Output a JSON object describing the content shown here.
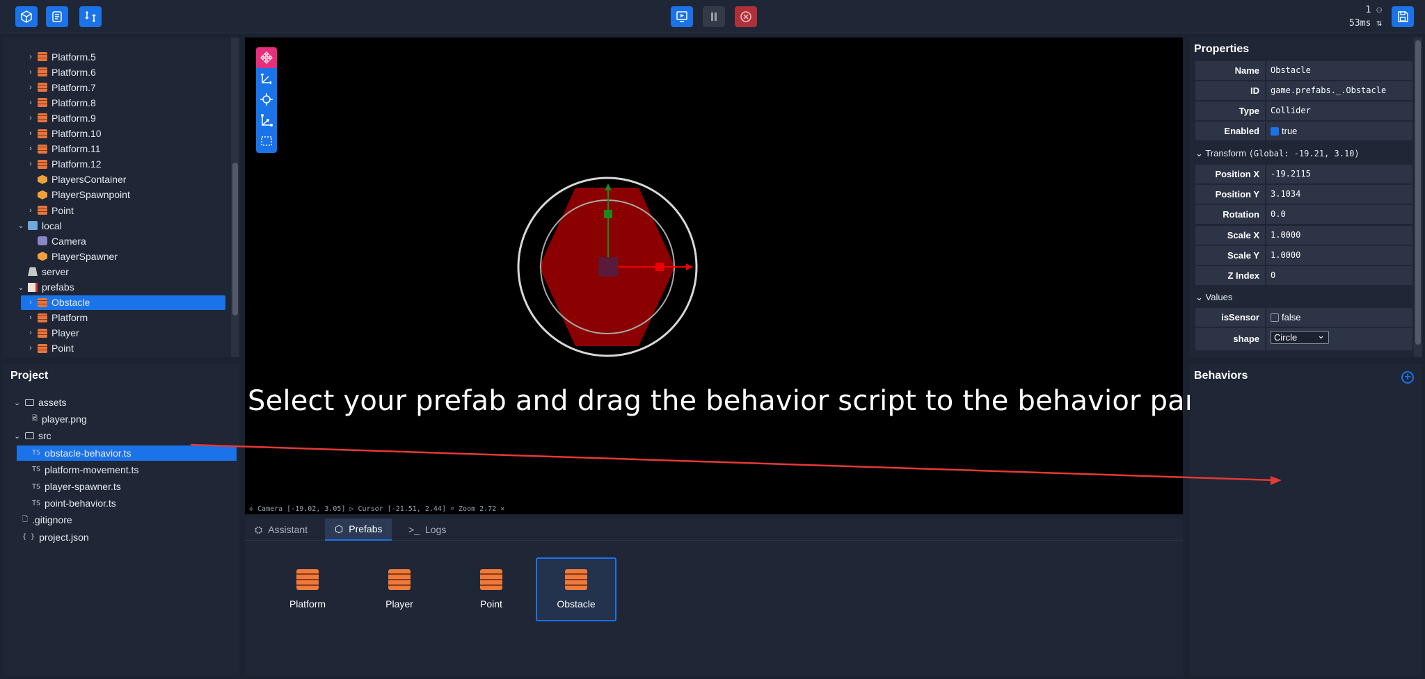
{
  "toolbar": {
    "left_icons": [
      "cube-icon",
      "scroll-icon",
      "swap-icon"
    ],
    "center_icons": [
      "play-icon",
      "pause-icon",
      "stop-icon"
    ],
    "save_icon": "save-icon",
    "players_count": "1",
    "latency": "53ms"
  },
  "scene_tree": {
    "items": [
      {
        "label": "Platform.5",
        "icon": "brick",
        "chevron": "›",
        "indent": 1
      },
      {
        "label": "Platform.6",
        "icon": "brick",
        "chevron": "›",
        "indent": 1
      },
      {
        "label": "Platform.7",
        "icon": "brick",
        "chevron": "›",
        "indent": 1
      },
      {
        "label": "Platform.8",
        "icon": "brick",
        "chevron": "›",
        "indent": 1
      },
      {
        "label": "Platform.9",
        "icon": "brick",
        "chevron": "›",
        "indent": 1
      },
      {
        "label": "Platform.10",
        "icon": "brick",
        "chevron": "›",
        "indent": 1
      },
      {
        "label": "Platform.11",
        "icon": "brick",
        "chevron": "›",
        "indent": 1
      },
      {
        "label": "Platform.12",
        "icon": "brick",
        "chevron": "›",
        "indent": 1
      },
      {
        "label": "PlayersContainer",
        "icon": "cube",
        "chevron": "",
        "indent": 1
      },
      {
        "label": "PlayerSpawnpoint",
        "icon": "cube",
        "chevron": "",
        "indent": 1
      },
      {
        "label": "Point",
        "icon": "brick",
        "chevron": "›",
        "indent": 1
      },
      {
        "label": "local",
        "icon": "laptop",
        "chevron": "⌄",
        "indent": 0
      },
      {
        "label": "Camera",
        "icon": "cam",
        "chevron": "",
        "indent": 1
      },
      {
        "label": "PlayerSpawner",
        "icon": "cube",
        "chevron": "",
        "indent": 1
      },
      {
        "label": "server",
        "icon": "srv",
        "chevron": "",
        "indent": 0
      },
      {
        "label": "prefabs",
        "icon": "doc",
        "chevron": "⌄",
        "indent": 0
      },
      {
        "label": "Obstacle",
        "icon": "brick",
        "chevron": "›",
        "indent": 1,
        "selected": true
      },
      {
        "label": "Platform",
        "icon": "brick",
        "chevron": "›",
        "indent": 1
      },
      {
        "label": "Player",
        "icon": "brick",
        "chevron": "›",
        "indent": 1
      },
      {
        "label": "Point",
        "icon": "brick",
        "chevron": "›",
        "indent": 1
      }
    ]
  },
  "project": {
    "title": "Project",
    "items": [
      {
        "label": "assets",
        "kind": "folder",
        "chevron": "⌄",
        "indent": 0
      },
      {
        "label": "player.png",
        "kind": "image",
        "chevron": "",
        "indent": 1
      },
      {
        "label": "src",
        "kind": "folder",
        "chevron": "⌄",
        "indent": 0
      },
      {
        "label": "obstacle-behavior.ts",
        "kind": "ts",
        "chevron": "",
        "indent": 1,
        "selected": true
      },
      {
        "label": "platform-movement.ts",
        "kind": "ts",
        "chevron": "",
        "indent": 1
      },
      {
        "label": "player-spawner.ts",
        "kind": "ts",
        "chevron": "",
        "indent": 1
      },
      {
        "label": "point-behavior.ts",
        "kind": "ts",
        "chevron": "",
        "indent": 1
      },
      {
        "label": ".gitignore",
        "kind": "file",
        "chevron": "",
        "indent": 0
      },
      {
        "label": "project.json",
        "kind": "json",
        "chevron": "",
        "indent": 0
      }
    ]
  },
  "viewport": {
    "overlay_text": "Select your prefab and drag the behavior script to the behavior panel",
    "status": "✢ Camera [-19.02, 3.05]  ▷ Cursor [-21.51, 2.44]  ⌕ Zoom 2.72 ×",
    "tools": [
      "move-gizmo-icon",
      "axes-icon",
      "rotate-icon",
      "scale-icon",
      "select-box-icon"
    ]
  },
  "bottom_tabs": {
    "tabs": [
      {
        "label": "Assistant",
        "icon": "robot-icon"
      },
      {
        "label": "Prefabs",
        "icon": "cube-icon",
        "active": true
      },
      {
        "label": "Logs",
        "icon": "terminal-icon"
      }
    ],
    "prefabs": [
      {
        "label": "Platform"
      },
      {
        "label": "Player"
      },
      {
        "label": "Point"
      },
      {
        "label": "Obstacle",
        "selected": true
      }
    ]
  },
  "properties": {
    "title": "Properties",
    "name_label": "Name",
    "name_value": "Obstacle",
    "id_label": "ID",
    "id_value": "game.prefabs._.Obstacle",
    "type_label": "Type",
    "type_value": "Collider",
    "enabled_label": "Enabled",
    "enabled_value": "true",
    "transform_label": "Transform",
    "transform_global": "(Global: -19.21, 3.10)",
    "transform_rows": [
      {
        "label": "Position X",
        "value": "-19.2115"
      },
      {
        "label": "Position Y",
        "value": "3.1034"
      },
      {
        "label": "Rotation",
        "value": "0.0"
      },
      {
        "label": "Scale X",
        "value": "1.0000"
      },
      {
        "label": "Scale Y",
        "value": "1.0000"
      },
      {
        "label": "Z Index",
        "value": "0"
      }
    ],
    "values_label": "Values",
    "issensor_label": "isSensor",
    "issensor_value": "false",
    "shape_label": "shape",
    "shape_value": "Circle"
  },
  "behaviors": {
    "title": "Behaviors"
  },
  "colors": {
    "accent": "#1a73e8",
    "shape_fill": "#8b0000",
    "arrow": "#e53935"
  }
}
